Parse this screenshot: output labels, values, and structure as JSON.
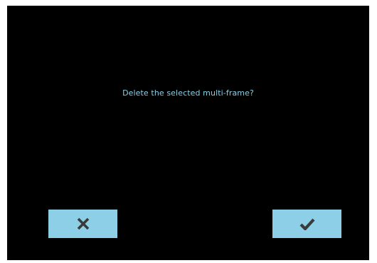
{
  "dialog": {
    "message": "Delete the selected multi-frame?",
    "cancel_icon": "close-icon",
    "confirm_icon": "checkmark-icon"
  },
  "colors": {
    "background": "#000000",
    "accent": "#8ccfe6",
    "icon": "#3a3a3a",
    "border": "#ffffff"
  }
}
